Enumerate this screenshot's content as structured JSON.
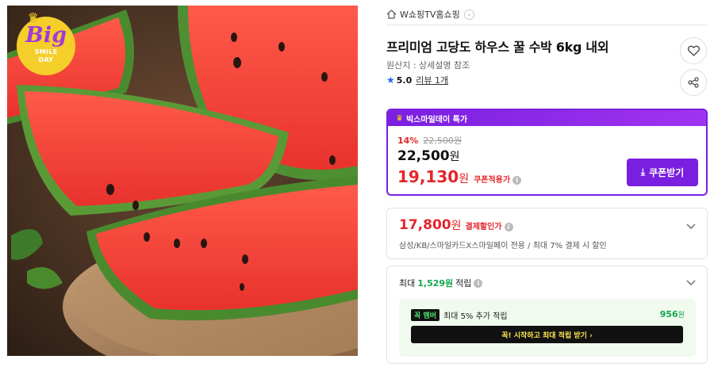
{
  "image": {
    "badge_word": "Big",
    "badge_line1": "SMILE",
    "badge_line2": "DAY"
  },
  "store": {
    "name": "W쇼핑TV홈쇼핑",
    "home_icon": "home-icon",
    "link_icon": "chevron-right-icon"
  },
  "product": {
    "title": "프리미엄 고당도 하우스 꿀 수박 6kg 내외",
    "origin": "원산지 : 상세설명 참조",
    "rating": "5.0",
    "review_link": "리뷰 1개"
  },
  "actions": {
    "wish_icon": "heart-icon",
    "share_icon": "share-icon"
  },
  "deal": {
    "header": "빅스마일데이 특가",
    "discount_pct": "14%",
    "original_price": "22,500원",
    "sale_price_num": "22,500",
    "coupon_price_num": "19,130",
    "won": "원",
    "coupon_label": "쿠폰적용가",
    "coupon_button": "쿠폰받기"
  },
  "card_discount": {
    "price_num": "17,800",
    "won": "원",
    "label": "결제할인가",
    "description": "삼성/KB/스마일카드X스마일페이 전용 / 최대 7% 결제 시 할인"
  },
  "reward": {
    "prefix": "최대",
    "amount": "1,529원",
    "suffix": "적립",
    "member_badge": "멤버",
    "member_badge_prefix": "꼭",
    "member_text": "최대 5% 추가 적립",
    "member_points_num": "956",
    "member_points_unit": "원",
    "member_button": "꼭! 시작하고 최대 적립 받기 ›"
  },
  "colors": {
    "accent_purple": "#7a1fe0",
    "price_red": "#e5252a",
    "reward_green": "#14a650",
    "rating_blue": "#1d6ee8"
  }
}
